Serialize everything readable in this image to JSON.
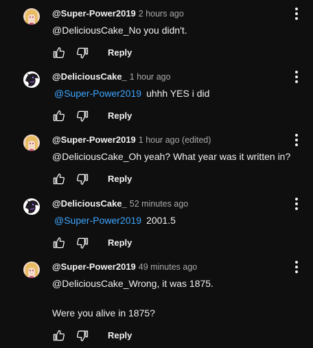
{
  "comments": [
    {
      "author": "@Super-Power2019",
      "time": "2 hours ago",
      "avatar": "super-power",
      "lines": [
        "@DeliciousCake_No you didn't."
      ],
      "mention": "",
      "mention_rest": "",
      "reply_label": "Reply"
    },
    {
      "author": "@DeliciousCake_",
      "time": "1 hour ago",
      "avatar": "delicious-cake",
      "lines": [],
      "mention": "@Super-Power2019",
      "mention_rest": "uhhh YES i did",
      "reply_label": "Reply"
    },
    {
      "author": "@Super-Power2019",
      "time": "1 hour ago (edited)",
      "avatar": "super-power",
      "lines": [
        "@DeliciousCake_Oh yeah? What year was it written in?"
      ],
      "mention": "",
      "mention_rest": "",
      "reply_label": "Reply"
    },
    {
      "author": "@DeliciousCake_",
      "time": "52 minutes ago",
      "avatar": "delicious-cake",
      "lines": [],
      "mention": "@Super-Power2019",
      "mention_rest": "2001.5",
      "reply_label": "Reply"
    },
    {
      "author": "@Super-Power2019",
      "time": "49 minutes ago",
      "avatar": "super-power",
      "lines": [
        "@DeliciousCake_Wrong, it was 1875.",
        "Were you alive in 1875?"
      ],
      "mention": "",
      "mention_rest": "",
      "reply_label": "Reply"
    }
  ],
  "icons": {
    "like": "thumbs-up-icon",
    "dislike": "thumbs-down-icon",
    "menu": "more-vert-icon"
  },
  "colors": {
    "background": "#0f0f0f",
    "text": "#f1f1f1",
    "secondary_text": "#aaaaaa",
    "mention": "#3ea6ff"
  }
}
